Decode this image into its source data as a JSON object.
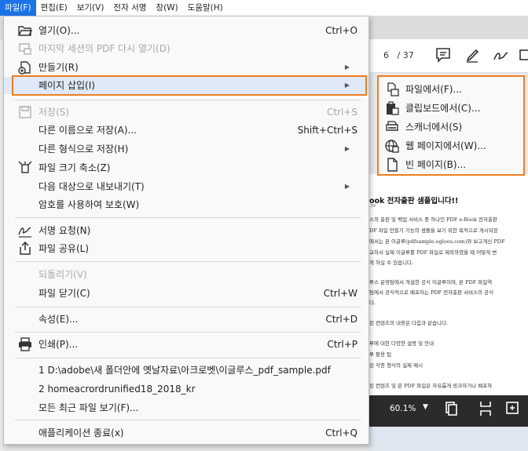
{
  "menubar": [
    "파일(F)",
    "편집(E)",
    "보기(V)",
    "전자 서명",
    "창(W)",
    "도움말(H)"
  ],
  "menu": {
    "items": [
      {
        "label": "열기(O)...",
        "shortcut": "Ctrl+O",
        "icon": "folder-open-icon",
        "disabled": false
      },
      {
        "label": "마지막 세션의 PDF 다시 열기(D)",
        "shortcut": "",
        "icon": "reopen-session-icon",
        "disabled": true
      },
      {
        "label": "만들기(R)",
        "shortcut": "",
        "icon": "create-icon",
        "disabled": false,
        "submenu": true
      },
      {
        "label": "페이지 삽입(I)",
        "shortcut": "",
        "icon": "",
        "disabled": false,
        "submenu": true,
        "highlighted": true
      },
      {
        "label": "저장(S)",
        "shortcut": "Ctrl+S",
        "icon": "save-icon",
        "disabled": true
      },
      {
        "label": "다른 이름으로 저장(A)...",
        "shortcut": "Shift+Ctrl+S",
        "icon": "",
        "disabled": false
      },
      {
        "label": "다른 형식으로 저장(H)",
        "shortcut": "",
        "icon": "",
        "disabled": false,
        "submenu": true
      },
      {
        "label": "파일 크기 축소(Z)",
        "shortcut": "",
        "icon": "compress-icon",
        "disabled": false
      },
      {
        "label": "다음 대상으로 내보내기(T)",
        "shortcut": "",
        "icon": "",
        "disabled": false,
        "submenu": true
      },
      {
        "label": "암호를 사용하여 보호(W)",
        "shortcut": "",
        "icon": "",
        "disabled": false
      },
      {
        "label": "서명 요청(N)",
        "shortcut": "",
        "icon": "sign-request-icon",
        "disabled": false
      },
      {
        "label": "파일 공유(L)",
        "shortcut": "",
        "icon": "share-icon",
        "disabled": false
      },
      {
        "label": "되돌리기(V)",
        "shortcut": "",
        "icon": "",
        "disabled": true
      },
      {
        "label": "파일 닫기(C)",
        "shortcut": "Ctrl+W",
        "icon": "",
        "disabled": false
      },
      {
        "label": "속성(E)...",
        "shortcut": "Ctrl+D",
        "icon": "",
        "disabled": false
      },
      {
        "label": "인쇄(P)...",
        "shortcut": "Ctrl+P",
        "icon": "printer-icon",
        "disabled": false
      },
      {
        "label": "1 D:\\adobe\\새 폴더안에 옛날자료\\아크로벳\\이글루스_pdf_sample.pdf",
        "shortcut": "",
        "icon": "",
        "disabled": false
      },
      {
        "label": "2 homeacrordrunified18_2018_kr",
        "shortcut": "",
        "icon": "",
        "disabled": false
      },
      {
        "label": "모든 최근 파일 보기(F)...",
        "shortcut": "",
        "icon": "",
        "disabled": false
      },
      {
        "label": "애플리케이션 종료(x)",
        "shortcut": "Ctrl+Q",
        "icon": "",
        "disabled": false
      }
    ]
  },
  "submenu": {
    "items": [
      {
        "label": "파일에서(F)...",
        "icon": "from-file-icon"
      },
      {
        "label": "클립보드에서(C)...",
        "icon": "clipboard-icon"
      },
      {
        "label": "스캐너에서(S)",
        "icon": "scanner-icon"
      },
      {
        "label": "웹 페이지에서(W)...",
        "icon": "web-page-icon"
      },
      {
        "label": "빈 페이지(B)...",
        "icon": "blank-page-icon"
      }
    ]
  },
  "viewer": {
    "page_current": "6",
    "page_total": "/ 37",
    "zoom": "60.1%",
    "doc_title": "ook 전자출판 샘플입니다!!",
    "doc_sub": ".09",
    "doc_lines": [
      "스의 출판 및 백업 서비스 중 하나인 PDF e-Book 전자출판",
      "DF 파일 만들기 기능의 샘플을 보기 위한 목적으로 게시되었",
      "에서는 본 이글루(pdfsample.egloos.com)와 보고게신 PDF",
      "교하서 실제 이글루를 PDF 파일로 제작하였을 때 어떻게 변",
      "게 하실 수 있습니다.",
      "루스 운영팀에서 개설한 공식 이글루이며, 본 PDF 파일역",
      "팀에서 공식적으로 배포하는 PDF 전자출판 서비스의 공식",
      "다.",
      "된 컨텐츠의 내용은 다음과 같습니다.",
      "루에 대한 다양한 설명 및 안내",
      "루 활용 팁",
      "된 각종 형식의 실제 예시",
      "된 컨텐츠 및 본 PDF 파일은 자유롭게 링크하거나 배포하"
    ]
  },
  "colors": {
    "accent_orange": "#ef7d22",
    "menubar_active": "#1a73e8",
    "highlight": "#dfe9f7"
  }
}
